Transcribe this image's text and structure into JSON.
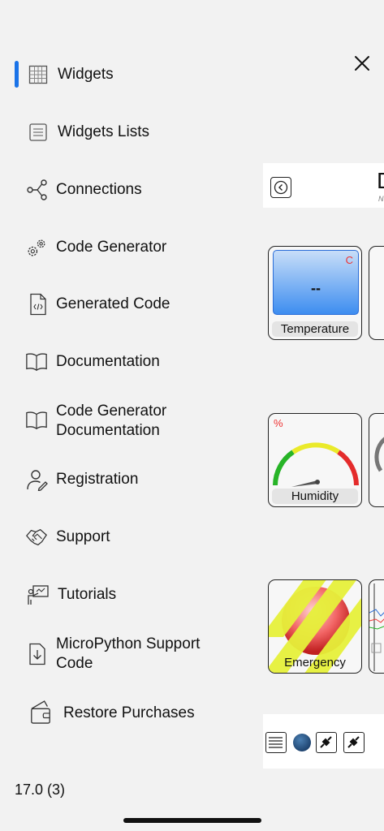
{
  "menu": {
    "items": [
      {
        "label": "Widgets",
        "icon": "grid-icon"
      },
      {
        "label": "Widgets Lists",
        "icon": "list-icon"
      },
      {
        "label": "Connections",
        "icon": "share-nodes-icon"
      },
      {
        "label": "Code Generator",
        "icon": "gears-icon"
      },
      {
        "label": "Generated Code",
        "icon": "code-file-icon"
      },
      {
        "label": "Documentation",
        "icon": "book-icon"
      },
      {
        "label": "Code Generator\nDocumentation",
        "icon": "book-icon"
      },
      {
        "label": "Registration",
        "icon": "user-sign-icon"
      },
      {
        "label": "Support",
        "icon": "handshake-icon"
      },
      {
        "label": "Tutorials",
        "icon": "presenter-icon"
      },
      {
        "label": "MicroPython Support\nCode",
        "icon": "download-file-icon"
      },
      {
        "label": "Restore Purchases",
        "icon": "wallet-icon"
      }
    ],
    "active_index": 0,
    "accent_color": "#1a73e8"
  },
  "version": "17.0 (3)",
  "preview": {
    "title_letter": "D",
    "subtitle": "N",
    "cards": {
      "temperature": {
        "label": "Temperature",
        "value": "--",
        "unit": "C"
      },
      "humidity": {
        "label": "Humidity",
        "unit": "%"
      },
      "emergency": {
        "label": "Emergency"
      }
    }
  }
}
